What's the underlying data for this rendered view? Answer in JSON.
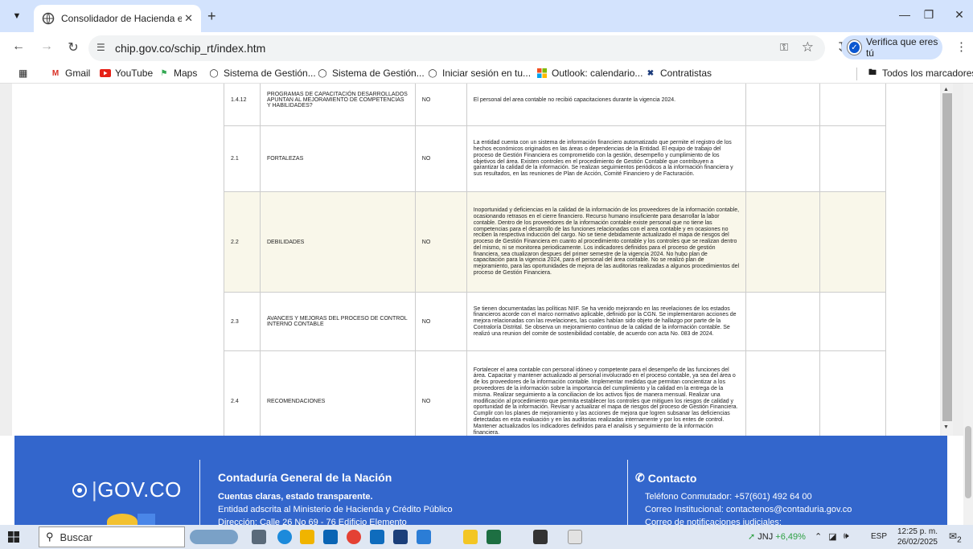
{
  "browser": {
    "tab_title": "Consolidador de Hacienda e Inf",
    "url": "chip.gov.co/schip_rt/index.htm",
    "verify_label": "Verifica que eres tú"
  },
  "bookmarks": {
    "items": [
      {
        "label": "Gmail"
      },
      {
        "label": "YouTube"
      },
      {
        "label": "Maps"
      },
      {
        "label": "Sistema de Gestión..."
      },
      {
        "label": "Sistema de Gestión..."
      },
      {
        "label": "Iniciar sesión en tu..."
      },
      {
        "label": "Outlook: calendario..."
      },
      {
        "label": "Contratistas"
      }
    ],
    "all_label": "Todos los marcadores"
  },
  "table": {
    "rows": [
      {
        "code": "1.4.12",
        "name": "PROGRAMAS DE CAPACITACIÓN DESARROLLADOS APUNTAN AL MEJORAMIENTO DE COMPETENCIAS Y HABILIDADES?",
        "value": "NO",
        "desc": "El personal del area contable no recibió capacitaciones durante la vigencia 2024.",
        "highlight": false
      },
      {
        "code": "2.1",
        "name": "FORTALEZAS",
        "value": "NO",
        "desc": "La entidad cuenta con un sistema de información financiero automatizado que permite el registro de los hechos económicos originados en las áreas o dependencias de la Entidad. El equipo de trabajo del proceso de Gestión Financiera es comprometido con la gestión, desempeño y cumplimiento de los objetivos del área. Existen controles en el procedimiento de Gestión Contable que contribuyen a garantizar la calidad de la información. Se realizan seguimientos periódicos a la información financiera y sus resultados, en las reuniones de Plan de Acción, Comité Financiero y de Facturación.",
        "highlight": false
      },
      {
        "code": "2.2",
        "name": "DEBILIDADES",
        "value": "NO",
        "desc": "Inoportunidad y deficiencias en la calidad de la información de los proveedores de la información contable, ocasionando retrasos en el cierre financiero. Recurso humano insuficiente para desarrollar la labor contable. Dentro de los proveedores de la información contable existe personal que no tiene las competencias para el desarrollo de las funciones relacionadas con el area contable y en ocasiones no reciben la respectiva inducción del cargo. No se tiene debidamente actualizado el mapa de riesgos del proceso de Gestión Financiera en cuanto al procedimiento contable y los controles que se realizan dentro del mismo, ni se monitorea periodicamente. Los indicadores definidos para el proceso de gestión financiera, sea ctualizaron despues del primer semestre de la vigencia 2024. No hubo plan de capacitación para la vigencia 2024, para el personal del área contable. No se realizó plan de mejoramiento, para las oportunidades de mejora de las auditorias realizadas a algunos procedimientos del proceso de Gestión Financiera.",
        "highlight": true
      },
      {
        "code": "2.3",
        "name": "AVANCES Y MEJORAS DEL PROCESO DE CONTROL INTERNO CONTABLE",
        "value": "NO",
        "desc": "Se tienen documentadas las políticas NIIF. Se ha venido mejorando en las revelaciones de los estados financieros acorde con el marco normativo aplicable, definido por la CGN. Se implementaron acciones de mejora relacionadas con las revelaciones, las cuales habían sido objeto de hallazgo por parte de la Contraloría Distrital. Se observa un mejoramiento continuo de la calidad de la información contable. Se realizó una reunion del comite de sostenibilidad contable, de acuerdo con acta No. 083 de 2024.",
        "highlight": false
      },
      {
        "code": "2.4",
        "name": "RECOMENDACIONES",
        "value": "NO",
        "desc": "Fortalecer el area contable con personal idóneo y competente para el desempeño de las funciones del área. Capacitar y mantener actualizado al personal involucrado en el proceso contable, ya sea del área o de los proveedores de la información contable. Implementar medidas que permitan concientizar a los proveedores de la información sobre la importancia del cumplimiento y la calidad en la entrega de la misma. Realizar seguimiento a la conciliacion de los activos fijos de manera mensual. Realizar una modificación al procedimiento que permita establecer los controles que mitiguen los riesgos de calidad y oportunidad de la información. Revisar y actualizar el mapa de riesgos del proceso de Gestión Financiera. Cumplir con los planes de mejoramiento y las acciones de mejora que logren subsanar las deficiencias detectadas en esta evaluación y en las auditorias realizadas internamente y por los entes de control. Mantener actualizados los indicadores definidos para el analisis y seguimiento de la información financiera.",
        "highlight": false
      }
    ]
  },
  "footer": {
    "logo": "GOV.CO",
    "org_title": "Contaduría General de la Nación",
    "org_slogan": "Cuentas claras, estado transparente.",
    "org_line1": "Entidad adscrita al Ministerio de Hacienda y Crédito Público",
    "org_line2": "Dirección: Calle 26 No 69 - 76 Edificio Elemento",
    "contact_title": "Contacto",
    "contact_phone": "Teléfono Conmutador: +57(601) 492 64 00",
    "contact_email": "Correo Institucional: contactenos@contaduria.gov.co",
    "contact_notif": "Correo de notificaciones judiciales:"
  },
  "taskbar": {
    "search_label": "Buscar",
    "stock_name": "JNJ",
    "stock_change": "+6,49%",
    "lang": "ESP",
    "time": "12:25 p. m.",
    "date": "26/02/2025",
    "notif_count": "2"
  },
  "colors": {
    "footer_bg": "#3366cc",
    "tab_strip": "#d3e3fd",
    "highlight_row": "#f9f7ea"
  }
}
